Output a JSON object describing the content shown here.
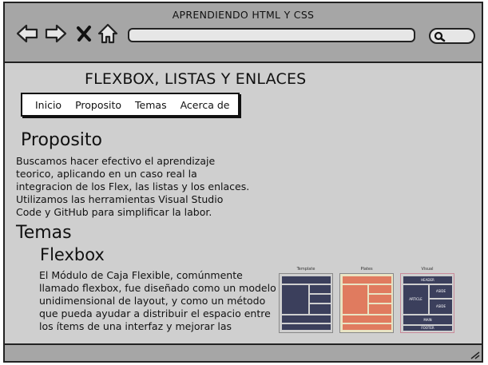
{
  "window": {
    "title": "APRENDIENDO HTML Y CSS"
  },
  "toolbar": {
    "back_icon": "arrow-left-icon",
    "forward_icon": "arrow-right-icon",
    "close_icon": "x-icon",
    "home_icon": "home-icon",
    "url_value": "",
    "search_icon": "search-icon"
  },
  "page": {
    "title": "FLEXBOX,  LISTAS Y ENLACES",
    "menu": [
      "Inicio",
      "Proposito",
      "Temas",
      "Acerca de"
    ],
    "proposito": {
      "heading": "Proposito",
      "lines": [
        "Buscamos hacer efectivo el aprendizaje",
        "teorico, aplicando en un caso real la",
        "integracion de los Flex, las listas y los enlaces.",
        "Utilizamos las herramientas Visual Studio",
        "Code y GitHub para simplificar la labor."
      ]
    },
    "temas": {
      "heading": "Temas",
      "flexbox": {
        "heading": "Flexbox",
        "lines": [
          "El Módulo de Caja Flexible, comúnmente",
          "llamado flexbox, fue diseñado como un modelo",
          "unidimensional de layout, y como un método",
          "que pueda ayudar a distribuir el espacio entre",
          "los ítems de una interfaz y mejorar las"
        ]
      }
    },
    "thumbnails": [
      {
        "label": "Template",
        "color": "#3b3f5c"
      },
      {
        "label": "Plates",
        "color": "#e07b5f"
      },
      {
        "label": "Visual",
        "color": "#3b3f5c",
        "texts": [
          "HEADER",
          "ARTICLE",
          "ASIDE",
          "ASIDE",
          "MAIN",
          "FOOTER"
        ]
      }
    ]
  },
  "colors": {
    "chrome": "#a6a6a6",
    "page_bg": "#cfcfcf",
    "dark_block": "#3b3f5c",
    "salmon_block": "#e07b5f"
  }
}
